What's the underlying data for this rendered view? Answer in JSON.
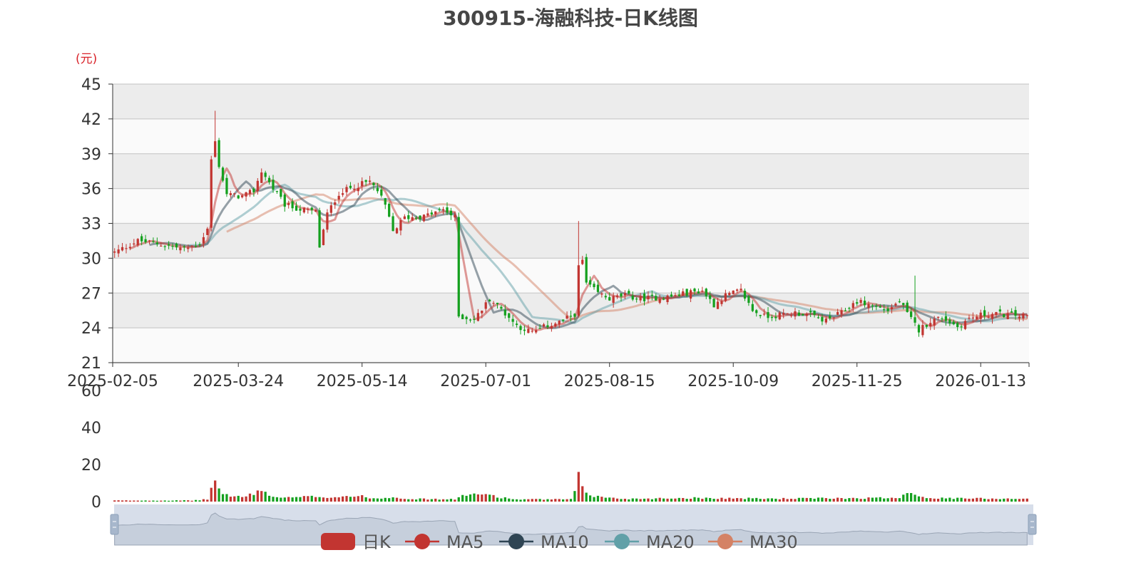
{
  "chart_data": {
    "type": "candlestick",
    "title": "300915-海融科技-日K线图",
    "unit_label": "(元)",
    "price_axis": {
      "min": 21,
      "max": 45,
      "ticks": [
        21,
        24,
        27,
        30,
        33,
        36,
        39,
        42,
        45
      ]
    },
    "volume_axis": {
      "min": 0,
      "max": 60,
      "ticks": [
        0,
        20,
        40,
        60
      ]
    },
    "x_tick_labels": [
      "2025-02-05",
      "2025-03-24",
      "2025-05-14",
      "2025-07-01",
      "2025-08-15",
      "2025-10-09",
      "2025-11-25",
      "2026-01-13"
    ],
    "up_color": "#c23531",
    "down_color": "#14a01e",
    "grid": true,
    "legend_position": "bottom",
    "legend": [
      {
        "name": "日K",
        "color": "#c23531",
        "type": "rect"
      },
      {
        "name": "MA5",
        "color": "#c23531",
        "type": "line"
      },
      {
        "name": "MA10",
        "color": "#2f4554",
        "type": "line"
      },
      {
        "name": "MA20",
        "color": "#61a0a8",
        "type": "line"
      },
      {
        "name": "MA30",
        "color": "#d48265",
        "type": "line"
      }
    ],
    "close_path": [
      [
        0,
        30.5
      ],
      [
        6,
        31.5
      ],
      [
        12,
        31.2
      ],
      [
        18,
        30.8
      ],
      [
        22,
        31.3
      ],
      [
        24,
        32.5
      ],
      [
        25,
        38.5
      ],
      [
        26,
        40.0
      ],
      [
        27,
        38.0
      ],
      [
        29,
        35.5
      ],
      [
        33,
        35.3
      ],
      [
        36,
        35.8
      ],
      [
        38,
        37.5
      ],
      [
        41,
        36.0
      ],
      [
        44,
        34.6
      ],
      [
        48,
        34.2
      ],
      [
        52,
        34.0
      ],
      [
        53,
        31.0
      ],
      [
        55,
        33.8
      ],
      [
        58,
        35.6
      ],
      [
        62,
        36.2
      ],
      [
        66,
        36.6
      ],
      [
        68,
        35.8
      ],
      [
        70,
        34.5
      ],
      [
        72,
        32.3
      ],
      [
        75,
        33.5
      ],
      [
        80,
        33.6
      ],
      [
        85,
        34.2
      ],
      [
        88,
        33.5
      ],
      [
        89,
        25.0
      ],
      [
        93,
        24.7
      ],
      [
        97,
        26.5
      ],
      [
        100,
        25.6
      ],
      [
        104,
        24.2
      ],
      [
        108,
        23.6
      ],
      [
        112,
        24.2
      ],
      [
        116,
        24.6
      ],
      [
        119,
        25.2
      ],
      [
        120,
        29.2
      ],
      [
        121,
        29.8
      ],
      [
        122,
        27.8
      ],
      [
        125,
        27.0
      ],
      [
        128,
        26.5
      ],
      [
        132,
        26.8
      ],
      [
        136,
        26.5
      ],
      [
        140,
        26.6
      ],
      [
        144,
        26.7
      ],
      [
        148,
        27.0
      ],
      [
        152,
        27.2
      ],
      [
        155,
        26.0
      ],
      [
        158,
        26.8
      ],
      [
        162,
        27.2
      ],
      [
        165,
        25.5
      ],
      [
        168,
        25.0
      ],
      [
        172,
        25.1
      ],
      [
        176,
        25.3
      ],
      [
        180,
        25.1
      ],
      [
        184,
        24.6
      ],
      [
        188,
        25.3
      ],
      [
        192,
        26.3
      ],
      [
        196,
        25.9
      ],
      [
        200,
        25.5
      ],
      [
        203,
        26.3
      ],
      [
        205,
        25.2
      ],
      [
        208,
        23.8
      ],
      [
        211,
        24.6
      ],
      [
        214,
        24.9
      ],
      [
        218,
        24.1
      ],
      [
        221,
        24.8
      ],
      [
        224,
        25.1
      ],
      [
        228,
        25.2
      ],
      [
        232,
        25.1
      ],
      [
        236,
        25.0
      ]
    ],
    "volume_path": [
      [
        0,
        0.6
      ],
      [
        20,
        0.6
      ],
      [
        24,
        1.2
      ],
      [
        25,
        7.5
      ],
      [
        26,
        11.0
      ],
      [
        27,
        6.5
      ],
      [
        29,
        3.5
      ],
      [
        33,
        2.5
      ],
      [
        36,
        4.0
      ],
      [
        38,
        7.0
      ],
      [
        40,
        3.0
      ],
      [
        44,
        2.0
      ],
      [
        52,
        2.8
      ],
      [
        56,
        2.3
      ],
      [
        60,
        3.0
      ],
      [
        64,
        2.8
      ],
      [
        68,
        1.6
      ],
      [
        72,
        2.6
      ],
      [
        76,
        1.5
      ],
      [
        88,
        1.2
      ],
      [
        89,
        3.0
      ],
      [
        92,
        3.5
      ],
      [
        97,
        4.0
      ],
      [
        100,
        2.2
      ],
      [
        104,
        1.2
      ],
      [
        118,
        1.2
      ],
      [
        119,
        5.0
      ],
      [
        120,
        13.0
      ],
      [
        121,
        9.0
      ],
      [
        122,
        5.0
      ],
      [
        124,
        3.0
      ],
      [
        128,
        2.0
      ],
      [
        132,
        1.5
      ],
      [
        150,
        2.0
      ],
      [
        170,
        1.6
      ],
      [
        200,
        2.0
      ],
      [
        203,
        2.5
      ],
      [
        206,
        5.5
      ],
      [
        208,
        3.0
      ],
      [
        212,
        1.8
      ],
      [
        236,
        1.6
      ]
    ],
    "ma_periods": [
      5,
      10,
      20,
      30
    ],
    "data_zoom": {
      "start": 0,
      "end": 100
    }
  }
}
